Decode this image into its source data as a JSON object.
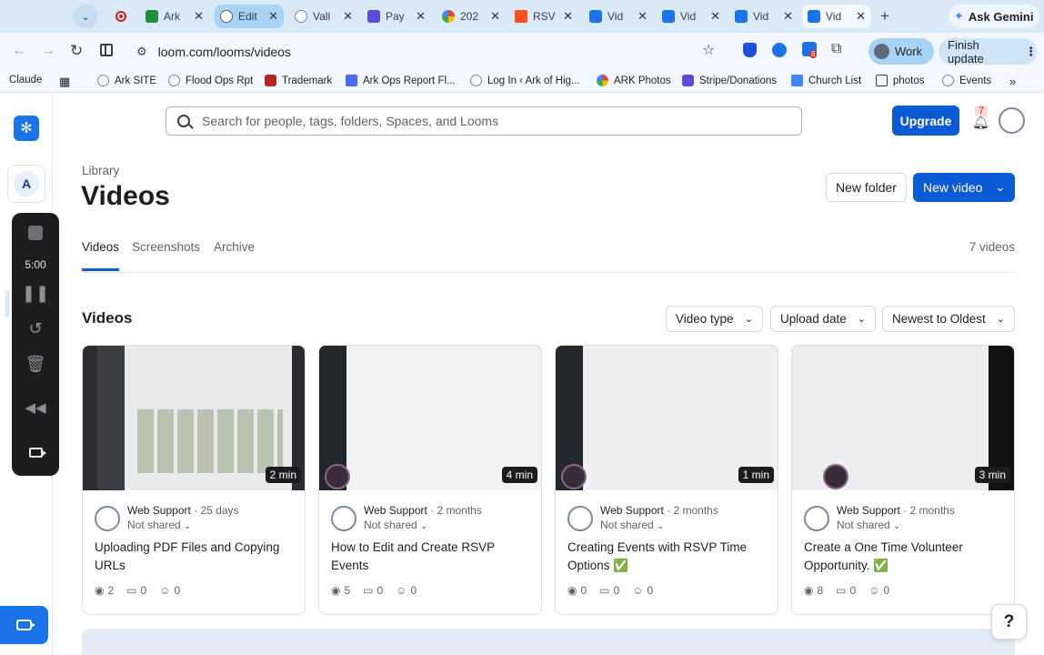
{
  "browser": {
    "tabs": [
      {
        "label": "",
        "kind": "control"
      },
      {
        "label": "",
        "kind": "record"
      },
      {
        "label": "Ark",
        "color": "#1e8e3e"
      },
      {
        "label": "Edit",
        "color": "#5f6368"
      },
      {
        "label": "Vall",
        "color": "#80868b"
      },
      {
        "label": "Pay",
        "color": "#5b4bdb"
      },
      {
        "label": "202",
        "color": "#fbbc04"
      },
      {
        "label": "RSV",
        "color": "#f4511e"
      },
      {
        "label": "Vid",
        "color": "#1a73e8"
      },
      {
        "label": "Vid",
        "color": "#1a73e8"
      },
      {
        "label": "Vid",
        "color": "#1a73e8"
      },
      {
        "label": "Vid",
        "color": "#1a73e8"
      }
    ],
    "gemini_label": "Ask Gemini",
    "url": "loom.com/looms/videos",
    "profile_label": "Work",
    "update_label": "Finish update",
    "extension_badge": "8",
    "bookmarks": [
      "Claude",
      "",
      "Ark SITE",
      "Flood Ops Rpt",
      "Trademark",
      "Ark Ops Report Fl...",
      "Log In ‹ Ark of Hig...",
      "ARK Photos",
      "Stripe/Donations",
      "Church List",
      "photos",
      "Events"
    ]
  },
  "app": {
    "search_placeholder": "Search for people, tags, folders, Spaces, and Looms",
    "upgrade_label": "Upgrade",
    "notifications_count": "7",
    "workspace_initial": "A",
    "recorder_time": "5:00",
    "breadcrumb": "Library",
    "page_title": "Videos",
    "new_folder_label": "New folder",
    "new_video_label": "New video",
    "tabs": [
      "Videos",
      "Screenshots",
      "Archive"
    ],
    "active_tab": "Videos",
    "video_count": "7 videos",
    "section_title": "Videos",
    "filters": [
      "Video type",
      "Upload date",
      "Newest to Oldest"
    ],
    "help_label": "?",
    "cards": [
      {
        "author": "Web Support",
        "age": "25 days",
        "sharing": "Not shared",
        "duration": "2 min",
        "title": "Uploading PDF Files and Copying URLs",
        "views": "2",
        "comments": "0",
        "reactions": "0"
      },
      {
        "author": "Web Support",
        "age": "2 months",
        "sharing": "Not shared",
        "duration": "4 min",
        "title": "How to Edit and Create RSVP Events",
        "views": "5",
        "comments": "0",
        "reactions": "0"
      },
      {
        "author": "Web Support",
        "age": "2 months",
        "sharing": "Not shared",
        "duration": "1 min",
        "title": "Creating Events with RSVP Time Options ✅",
        "views": "0",
        "comments": "0",
        "reactions": "0"
      },
      {
        "author": "Web Support",
        "age": "2 months",
        "sharing": "Not shared",
        "duration": "3 min",
        "title": "Create a One Time Volunteer Opportunity. ✅",
        "views": "8",
        "comments": "0",
        "reactions": "0"
      }
    ]
  },
  "colors": {
    "accent": "#0c5bd6",
    "tab_active": "#a8d3f5"
  }
}
